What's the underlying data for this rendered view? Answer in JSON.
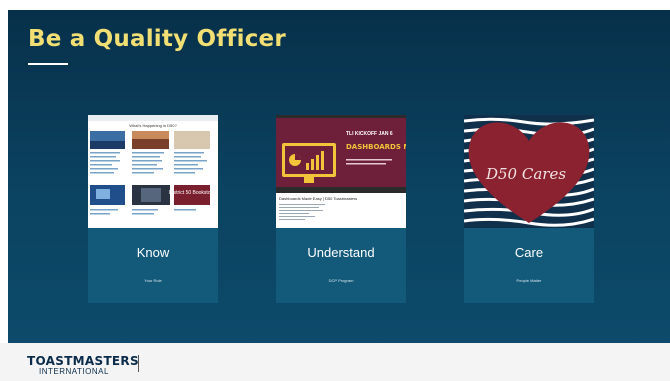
{
  "slide": {
    "title": "Be a Quality Officer",
    "cards": [
      {
        "label": "Know",
        "sub": "Your Role",
        "thumb_text": "What's Happening in D50?",
        "thumb_badge": "District 50 Bookstore"
      },
      {
        "label": "Understand",
        "sub": "DCP Program",
        "thumb_heading": "DASHBOARDS MADE EASY",
        "thumb_kicker": "TLI KICKOFF JAN 6",
        "thumb_caption": "Dashboards Made Easy | D50 Toastmasters"
      },
      {
        "label": "Care",
        "sub": "People Matter",
        "thumb_logo": "D50 Cares"
      }
    ]
  },
  "footer": {
    "brand": "TOASTMASTERS",
    "brand_sub": "INTERNATIONAL"
  },
  "colors": {
    "title": "#f2df74",
    "panel": "#135a7a",
    "heart": "#8b2230",
    "dashboard_bg": "#6e1f3a"
  }
}
